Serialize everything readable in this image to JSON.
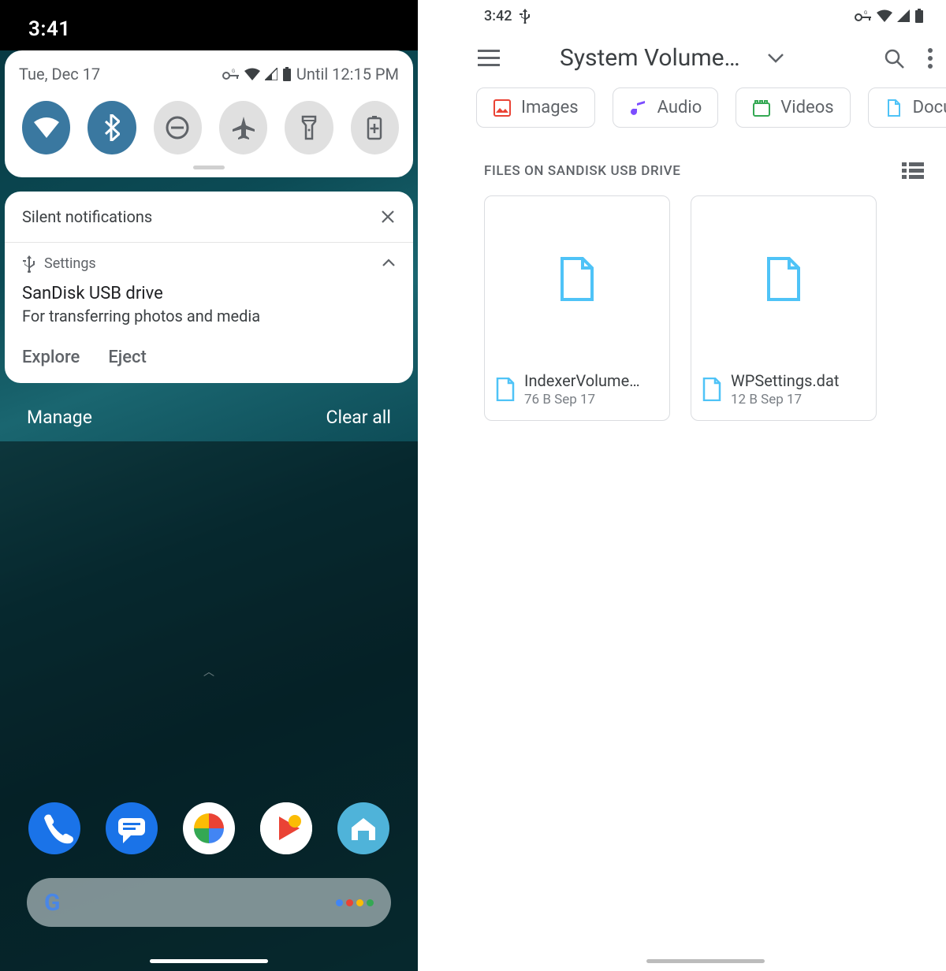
{
  "left": {
    "status_time": "3:41",
    "qs": {
      "date": "Tue, Dec 17",
      "alarm": "Until 12:15 PM",
      "tiles": [
        "wifi",
        "bluetooth",
        "dnd",
        "airplane",
        "flashlight",
        "battery-saver"
      ]
    },
    "silent_header": "Silent notifications",
    "notif": {
      "source": "Settings",
      "title": "SanDisk USB drive",
      "desc": "For transferring photos and media",
      "action_explore": "Explore",
      "action_eject": "Eject"
    },
    "manage": "Manage",
    "clear_all": "Clear all"
  },
  "right": {
    "status_time": "3:42",
    "appbar_title": "System Volume…",
    "chips": {
      "images": "Images",
      "audio": "Audio",
      "videos": "Videos",
      "documents": "Docu"
    },
    "section_label": "FILES ON SANDISK USB DRIVE",
    "files": [
      {
        "name": "IndexerVolume…",
        "info": "76 B  Sep 17"
      },
      {
        "name": "WPSettings.dat",
        "info": "12 B  Sep 17"
      }
    ]
  }
}
